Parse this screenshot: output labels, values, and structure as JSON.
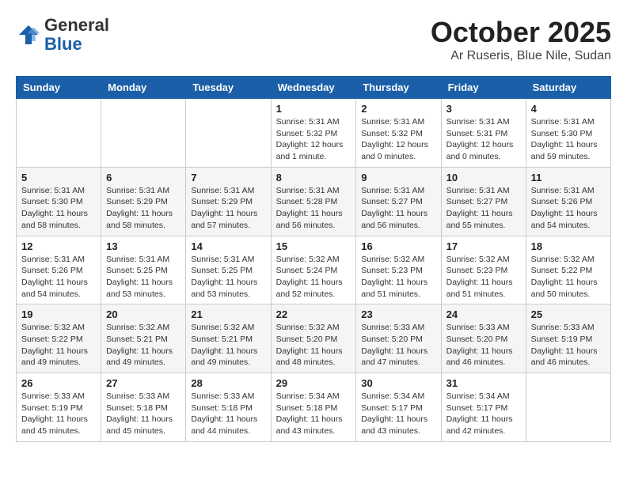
{
  "logo": {
    "general": "General",
    "blue": "Blue"
  },
  "header": {
    "month": "October 2025",
    "location": "Ar Ruseris, Blue Nile, Sudan"
  },
  "days_of_week": [
    "Sunday",
    "Monday",
    "Tuesday",
    "Wednesday",
    "Thursday",
    "Friday",
    "Saturday"
  ],
  "weeks": [
    [
      {
        "day": "",
        "info": ""
      },
      {
        "day": "",
        "info": ""
      },
      {
        "day": "",
        "info": ""
      },
      {
        "day": "1",
        "info": "Sunrise: 5:31 AM\nSunset: 5:32 PM\nDaylight: 12 hours\nand 1 minute."
      },
      {
        "day": "2",
        "info": "Sunrise: 5:31 AM\nSunset: 5:32 PM\nDaylight: 12 hours\nand 0 minutes."
      },
      {
        "day": "3",
        "info": "Sunrise: 5:31 AM\nSunset: 5:31 PM\nDaylight: 12 hours\nand 0 minutes."
      },
      {
        "day": "4",
        "info": "Sunrise: 5:31 AM\nSunset: 5:30 PM\nDaylight: 11 hours\nand 59 minutes."
      }
    ],
    [
      {
        "day": "5",
        "info": "Sunrise: 5:31 AM\nSunset: 5:30 PM\nDaylight: 11 hours\nand 58 minutes."
      },
      {
        "day": "6",
        "info": "Sunrise: 5:31 AM\nSunset: 5:29 PM\nDaylight: 11 hours\nand 58 minutes."
      },
      {
        "day": "7",
        "info": "Sunrise: 5:31 AM\nSunset: 5:29 PM\nDaylight: 11 hours\nand 57 minutes."
      },
      {
        "day": "8",
        "info": "Sunrise: 5:31 AM\nSunset: 5:28 PM\nDaylight: 11 hours\nand 56 minutes."
      },
      {
        "day": "9",
        "info": "Sunrise: 5:31 AM\nSunset: 5:27 PM\nDaylight: 11 hours\nand 56 minutes."
      },
      {
        "day": "10",
        "info": "Sunrise: 5:31 AM\nSunset: 5:27 PM\nDaylight: 11 hours\nand 55 minutes."
      },
      {
        "day": "11",
        "info": "Sunrise: 5:31 AM\nSunset: 5:26 PM\nDaylight: 11 hours\nand 54 minutes."
      }
    ],
    [
      {
        "day": "12",
        "info": "Sunrise: 5:31 AM\nSunset: 5:26 PM\nDaylight: 11 hours\nand 54 minutes."
      },
      {
        "day": "13",
        "info": "Sunrise: 5:31 AM\nSunset: 5:25 PM\nDaylight: 11 hours\nand 53 minutes."
      },
      {
        "day": "14",
        "info": "Sunrise: 5:31 AM\nSunset: 5:25 PM\nDaylight: 11 hours\nand 53 minutes."
      },
      {
        "day": "15",
        "info": "Sunrise: 5:32 AM\nSunset: 5:24 PM\nDaylight: 11 hours\nand 52 minutes."
      },
      {
        "day": "16",
        "info": "Sunrise: 5:32 AM\nSunset: 5:23 PM\nDaylight: 11 hours\nand 51 minutes."
      },
      {
        "day": "17",
        "info": "Sunrise: 5:32 AM\nSunset: 5:23 PM\nDaylight: 11 hours\nand 51 minutes."
      },
      {
        "day": "18",
        "info": "Sunrise: 5:32 AM\nSunset: 5:22 PM\nDaylight: 11 hours\nand 50 minutes."
      }
    ],
    [
      {
        "day": "19",
        "info": "Sunrise: 5:32 AM\nSunset: 5:22 PM\nDaylight: 11 hours\nand 49 minutes."
      },
      {
        "day": "20",
        "info": "Sunrise: 5:32 AM\nSunset: 5:21 PM\nDaylight: 11 hours\nand 49 minutes."
      },
      {
        "day": "21",
        "info": "Sunrise: 5:32 AM\nSunset: 5:21 PM\nDaylight: 11 hours\nand 49 minutes."
      },
      {
        "day": "22",
        "info": "Sunrise: 5:32 AM\nSunset: 5:20 PM\nDaylight: 11 hours\nand 48 minutes."
      },
      {
        "day": "23",
        "info": "Sunrise: 5:33 AM\nSunset: 5:20 PM\nDaylight: 11 hours\nand 47 minutes."
      },
      {
        "day": "24",
        "info": "Sunrise: 5:33 AM\nSunset: 5:20 PM\nDaylight: 11 hours\nand 46 minutes."
      },
      {
        "day": "25",
        "info": "Sunrise: 5:33 AM\nSunset: 5:19 PM\nDaylight: 11 hours\nand 46 minutes."
      }
    ],
    [
      {
        "day": "26",
        "info": "Sunrise: 5:33 AM\nSunset: 5:19 PM\nDaylight: 11 hours\nand 45 minutes."
      },
      {
        "day": "27",
        "info": "Sunrise: 5:33 AM\nSunset: 5:18 PM\nDaylight: 11 hours\nand 45 minutes."
      },
      {
        "day": "28",
        "info": "Sunrise: 5:33 AM\nSunset: 5:18 PM\nDaylight: 11 hours\nand 44 minutes."
      },
      {
        "day": "29",
        "info": "Sunrise: 5:34 AM\nSunset: 5:18 PM\nDaylight: 11 hours\nand 43 minutes."
      },
      {
        "day": "30",
        "info": "Sunrise: 5:34 AM\nSunset: 5:17 PM\nDaylight: 11 hours\nand 43 minutes."
      },
      {
        "day": "31",
        "info": "Sunrise: 5:34 AM\nSunset: 5:17 PM\nDaylight: 11 hours\nand 42 minutes."
      },
      {
        "day": "",
        "info": ""
      }
    ]
  ]
}
